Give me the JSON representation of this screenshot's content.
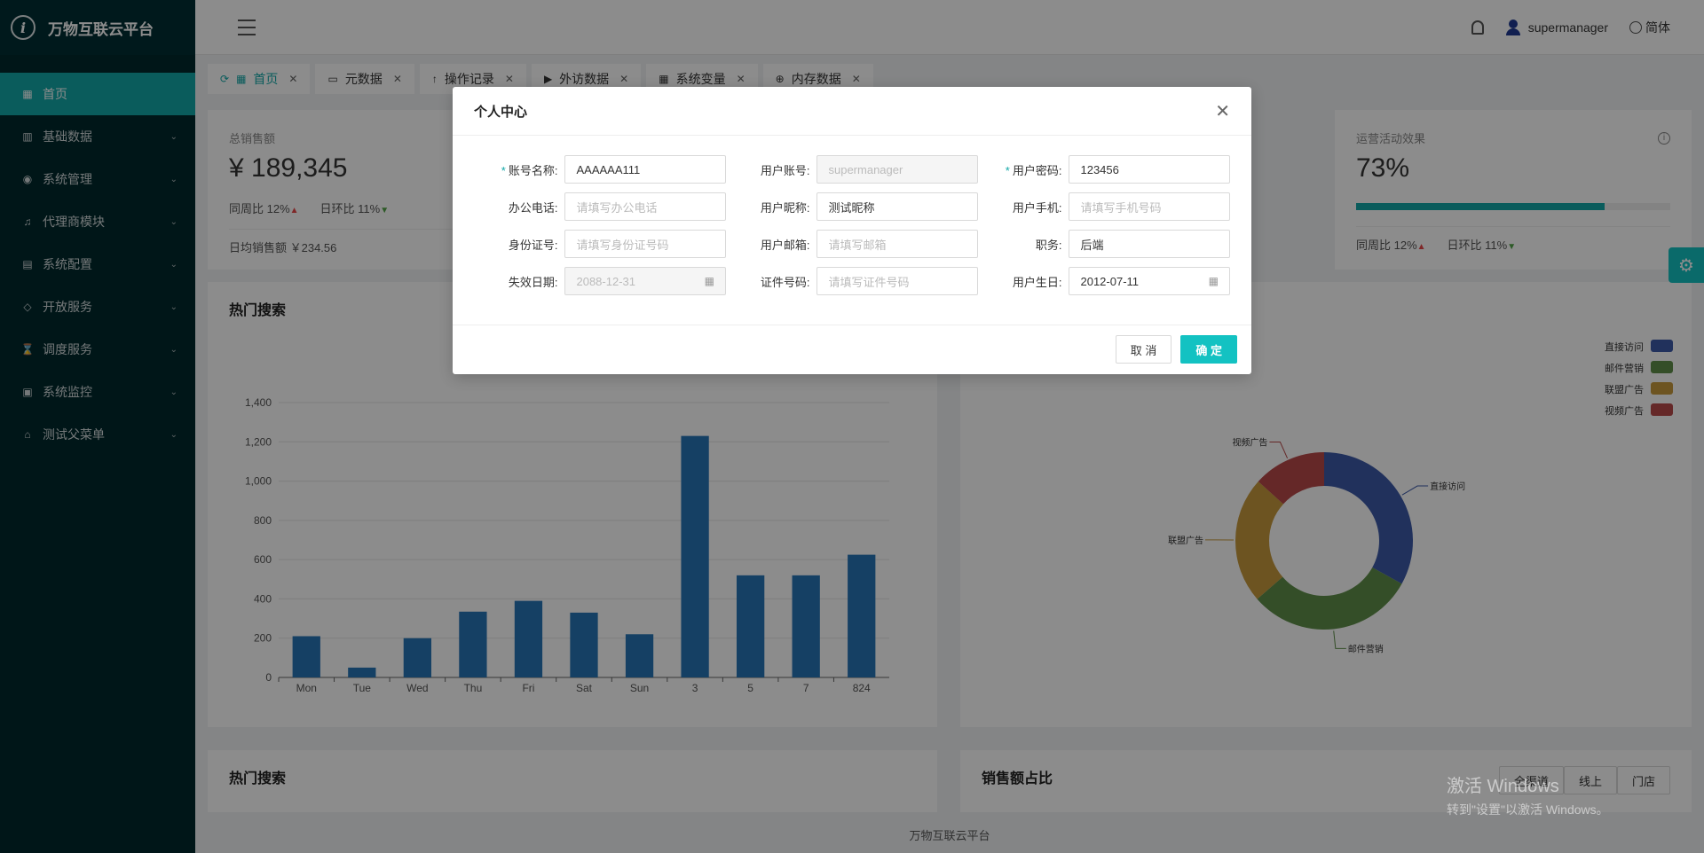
{
  "app": {
    "title": "万物互联云平台",
    "logo_letter": "i"
  },
  "sidebar": {
    "items": [
      {
        "label": "首页",
        "icon": "calendar-icon",
        "active": true
      },
      {
        "label": "基础数据",
        "icon": "barcode-icon"
      },
      {
        "label": "系统管理",
        "icon": "camera-icon"
      },
      {
        "label": "代理商模块",
        "icon": "bell-icon"
      },
      {
        "label": "系统配置",
        "icon": "grid-icon"
      },
      {
        "label": "开放服务",
        "icon": "tag-icon"
      },
      {
        "label": "调度服务",
        "icon": "hourglass-icon"
      },
      {
        "label": "系统监控",
        "icon": "monitor-icon"
      },
      {
        "label": "测试父菜单",
        "icon": "bank-icon"
      }
    ]
  },
  "header": {
    "username": "supermanager",
    "language": "简体"
  },
  "tabs": [
    {
      "label": "首页",
      "active": true
    },
    {
      "label": "元数据"
    },
    {
      "label": "操作记录"
    },
    {
      "label": "外访数据"
    },
    {
      "label": "系统变量"
    },
    {
      "label": "内存数据"
    }
  ],
  "stats": {
    "total_sales": {
      "title": "总销售额",
      "value": "¥ 189,345",
      "yoy": "同周比 12%",
      "dod": "日环比 11%",
      "daily": "日均销售额 ￥234.56"
    },
    "ops": {
      "title": "运营活动效果",
      "value": "73%",
      "progress": 0.79,
      "yoy": "同周比 12%",
      "dod": "日环比 11%"
    }
  },
  "cards": {
    "hot_search": "热门搜索",
    "hot_search_2": "热门搜索",
    "sales_share": "销售额占比",
    "channel_buttons": [
      "全渠道",
      "线上",
      "门店"
    ]
  },
  "chart_data": [
    {
      "type": "bar",
      "categories": [
        "Mon",
        "Tue",
        "Wed",
        "Thu",
        "Fri",
        "Sat",
        "Sun",
        "3",
        "5",
        "7",
        "824"
      ],
      "values": [
        210,
        50,
        200,
        335,
        390,
        330,
        220,
        1230,
        520,
        520,
        625
      ],
      "ylim": [
        0,
        1400
      ],
      "yticks": [
        "0",
        "200",
        "400",
        "600",
        "800",
        "1,000",
        "1,200",
        "1,400"
      ],
      "color": "#2775b6"
    },
    {
      "type": "pie",
      "labels": [
        "直接访问",
        "邮件营销",
        "联盟广告",
        "视频广告"
      ],
      "values": [
        335,
        310,
        234,
        135
      ],
      "colors": [
        "#3d5aa8",
        "#5f8f4a",
        "#c79a3c",
        "#b94a4a"
      ],
      "legend": "top-right"
    }
  ],
  "modal": {
    "title": "个人中心",
    "rows": [
      [
        {
          "label": "账号名称:",
          "required": true,
          "value": "AAAAAA111"
        },
        {
          "label": "用户账号:",
          "value": "supermanager",
          "disabled": true
        },
        {
          "label": "用户密码:",
          "required": true,
          "value": "123456"
        }
      ],
      [
        {
          "label": "办公电话:",
          "placeholder": "请填写办公电话"
        },
        {
          "label": "用户昵称:",
          "value": "测试昵称"
        },
        {
          "label": "用户手机:",
          "placeholder": "请填写手机号码"
        }
      ],
      [
        {
          "label": "身份证号:",
          "placeholder": "请填写身份证号码"
        },
        {
          "label": "用户邮箱:",
          "placeholder": "请填写邮箱"
        },
        {
          "label": "职务:",
          "value": "后端"
        }
      ],
      [
        {
          "label": "失效日期:",
          "value": "2088-12-31",
          "disabled": true,
          "date": true
        },
        {
          "label": "证件号码:",
          "placeholder": "请填写证件号码"
        },
        {
          "label": "用户生日:",
          "value": "2012-07-11",
          "date": true
        }
      ]
    ],
    "cancel_label": "取 消",
    "ok_label": "确 定"
  },
  "watermark": {
    "line1": "激活 Windows",
    "line2": "转到\"设置\"以激活 Windows。"
  },
  "footer": "万物互联云平台"
}
